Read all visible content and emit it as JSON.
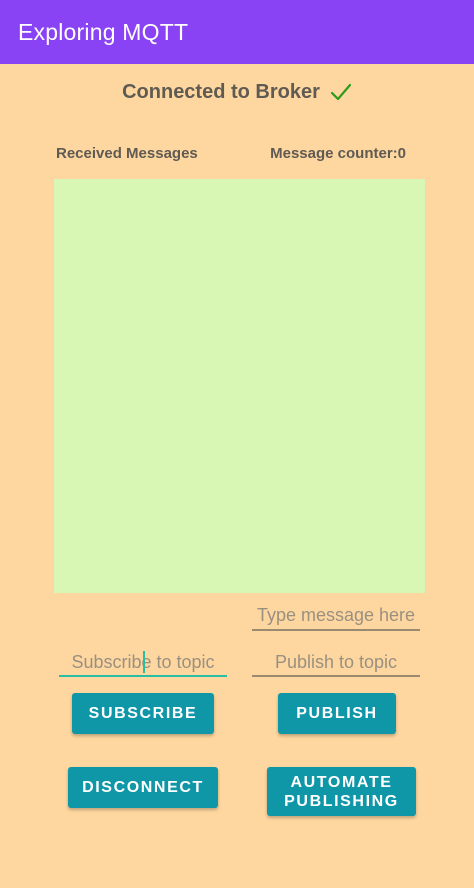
{
  "app_bar": {
    "title": "Exploring MQTT",
    "color": "#8a42f5"
  },
  "status": {
    "text": "Connected to Broker",
    "icon": "check-icon",
    "icon_color": "#2e9a1c"
  },
  "labels": {
    "received": "Received Messages",
    "counter": "Message counter:0"
  },
  "messages": {
    "background": "#d9f7b4"
  },
  "inputs": {
    "message_placeholder": "Type message here",
    "subscribe_placeholder": "Subscribe to topic",
    "publish_placeholder": "Publish to topic"
  },
  "buttons": {
    "subscribe": "SUBSCRIBE",
    "publish": "PUBLISH",
    "disconnect": "DISCONNECT",
    "automate_line1": "AUTOMATE",
    "automate_line2": "PUBLISHING",
    "color": "#0f97a8"
  },
  "theme": {
    "background": "#fed7a0",
    "accent": "#26bfa5"
  }
}
